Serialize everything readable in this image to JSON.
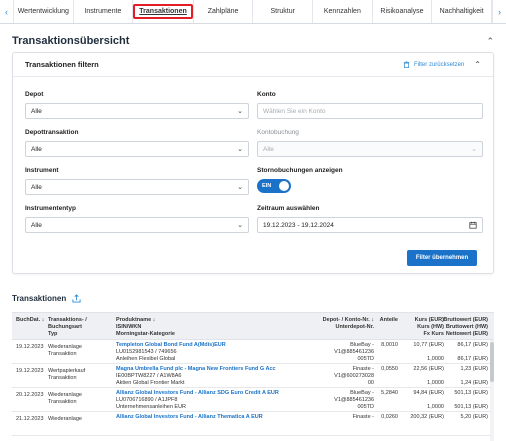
{
  "tabs": {
    "items": [
      "Wertentwicklung",
      "Instrumente",
      "Transaktionen",
      "Zahlpläne",
      "Struktur",
      "Kennzahlen",
      "Risikoanalyse",
      "Nachhaltigkeit"
    ],
    "active": "Transaktionen",
    "prev_glyph": "‹",
    "next_glyph": "›"
  },
  "overview": {
    "title": "Transaktionsübersicht"
  },
  "filter": {
    "title": "Transaktionen filtern",
    "reset_label": "Filter zurücksetzen",
    "depot": {
      "label": "Depot",
      "value": "Alle"
    },
    "konto": {
      "label": "Konto",
      "placeholder": "Wählen Sie ein Konto"
    },
    "depottransaktion": {
      "label": "Depottransaktion",
      "value": "Alle"
    },
    "kontobuchung": {
      "label": "Kontobuchung",
      "value": "Alle"
    },
    "instrument": {
      "label": "Instrument",
      "value": "Alle"
    },
    "storno": {
      "label": "Stornobuchungen anzeigen",
      "toggle_label": "EIN"
    },
    "instrumententyp": {
      "label": "Instrumententyp",
      "value": "Alle"
    },
    "zeitraum": {
      "label": "Zeitraum auswählen",
      "value": "19.12.2023 - 19.12.2024"
    },
    "apply_label": "Filter übernehmen"
  },
  "transactions": {
    "title": "Transaktionen",
    "headers": {
      "date": "BuchDat. ↓",
      "type": [
        "Transaktions- /",
        "Buchungsart",
        "Typ"
      ],
      "product": [
        "Produktname ↓",
        "ISIN/WKN",
        "Morningstar-Kategorie"
      ],
      "depot": [
        "Depot- / Konto-Nr. ↓",
        "Unterdepot-Nr."
      ],
      "anteile": "Anteile",
      "kurs": [
        "Kurs (EUR)",
        "Kurs (HW)",
        "Fx Kurs"
      ],
      "brutto": [
        "Bruttowert (EUR)",
        "Bruttowert (HW)",
        "Nettowert (EUR)"
      ]
    },
    "rows": [
      {
        "date": "19.12.2023",
        "type": [
          "Wiederanlage",
          "Transaktion"
        ],
        "product": [
          "Templeton Global Bond Fund A(Mdis)EUR",
          "LU0152981543 / 749656",
          "Anleihen Flexibel Global"
        ],
        "depot": [
          "BlueBay -",
          "V1@885461236",
          "005TD"
        ],
        "anteile": "8,0010",
        "kurs": [
          "10,77 (EUR)",
          "",
          "1,0000"
        ],
        "brutto": [
          "86,17 (EUR)",
          "",
          "86,17 (EUR)"
        ]
      },
      {
        "date": "19.12.2023",
        "type": [
          "Wertpapierkauf",
          "Transaktion"
        ],
        "product": [
          "Magna Umbrella Fund plc - Magna New Frontiers Fund G Acc",
          "IE00BPTW8227 / A1W8A6",
          "Aktien Global Frontier Markt"
        ],
        "depot": [
          "Finaste -",
          "V1@600273028",
          "00"
        ],
        "anteile": "0,0550",
        "kurs": [
          "22,56 (EUR)",
          "",
          "1,0000"
        ],
        "brutto": [
          "1,23 (EUR)",
          "",
          "1,24 (EUR)"
        ]
      },
      {
        "date": "20.12.2023",
        "type": [
          "Wiederanlage",
          "Transaktion"
        ],
        "product": [
          "Allianz Global Investors Fund - Allianz SDG Euro Credit A EUR",
          "LU0706716890 / A1JPF8",
          "Unternehmensanleihen EUR"
        ],
        "depot": [
          "BlueBay -",
          "V1@885461236",
          "005TD"
        ],
        "anteile": "5,2840",
        "kurs": [
          "94,84 (EUR)",
          "",
          "1,0000"
        ],
        "brutto": [
          "501,13 (EUR)",
          "",
          "501,13 (EUR)"
        ]
      },
      {
        "date": "21.12.2023",
        "type": [
          "Wiederanlage",
          ""
        ],
        "product": [
          "Allianz Global Investors Fund - Allianz Thematica A EUR",
          "",
          ""
        ],
        "depot": [
          "Finaste -",
          "",
          ""
        ],
        "anteile": "0,0260",
        "kurs": [
          "200,32 (EUR)",
          "",
          ""
        ],
        "brutto": [
          "5,20 (EUR)",
          "",
          ""
        ]
      }
    ]
  },
  "colors": {
    "accent": "#1a73c9",
    "active_tab_border": "#e41e26",
    "header_bg": "#eef0f3"
  }
}
